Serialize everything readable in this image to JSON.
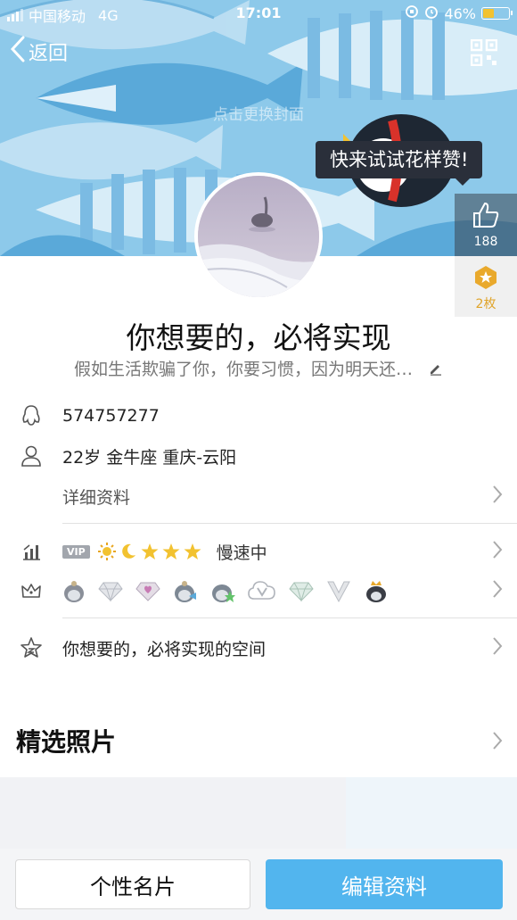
{
  "status_bar": {
    "carrier": "中国移动",
    "network": "4G",
    "time": "17:01",
    "battery": "46%",
    "battery_level": 0.46
  },
  "header": {
    "back_label": "返回",
    "change_cover": "点击更换封面",
    "tooltip": "快来试试花样赞!"
  },
  "likes": {
    "count": "188"
  },
  "medals": {
    "count": "2枚"
  },
  "profile": {
    "nickname": "你想要的，必将实现",
    "signature": "假如生活欺骗了你，你要习惯，因为明天还…"
  },
  "info": {
    "qq_number": "574757277",
    "basic": "22岁  金牛座  重庆-云阳",
    "details_label": "详细资料"
  },
  "level": {
    "vip_tag": "VIP",
    "status": "慢速中"
  },
  "space": {
    "label": "你想要的，必将实现的空间"
  },
  "featured": {
    "title": "精选照片"
  },
  "actions": {
    "card_label": "个性名片",
    "edit_label": "编辑资料"
  },
  "colors": {
    "cover_bg": "#8dc9ea",
    "accent_blue": "#52b5ee",
    "tooltip_bg": "#2a2f3a"
  }
}
